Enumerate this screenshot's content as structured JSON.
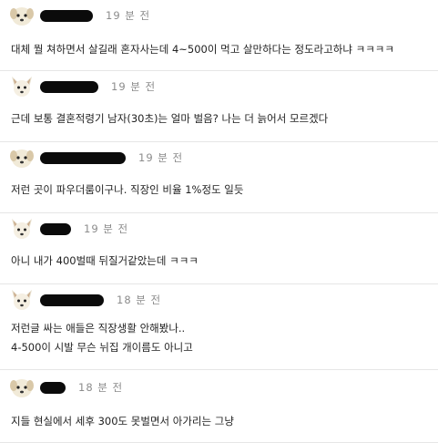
{
  "comments": [
    {
      "avatar": "white-puppy-avatar",
      "time": "19 분 전",
      "lines": [
        "대체 뭘 쳐하면서 살길래 혼자사는데 4~500이 먹고 살만하다는 정도라고하냐 ㅋㅋㅋㅋ"
      ]
    },
    {
      "avatar": "fox-avatar",
      "time": "19 분 전",
      "lines": [
        "근데 보통 결혼적령기 남자(30초)는 얼마 벌음? 나는 더 늙어서 모르겠다"
      ]
    },
    {
      "avatar": "white-puppy-avatar",
      "time": "19 분 전",
      "lines": [
        "저런 곳이 파우더룸이구나. 직장인 비율 1%정도 일듯"
      ]
    },
    {
      "avatar": "fox-avatar",
      "time": "19 분 전",
      "lines": [
        "아니 내가 400벌때 뒤질거같았는데 ㅋㅋㅋ"
      ]
    },
    {
      "avatar": "fox-avatar",
      "time": "18 분 전",
      "lines": [
        "저런글 싸는 애들은 직장생활 안해봤나..",
        "4-500이 시발 무슨 뉘집 개이름도 아니고"
      ]
    },
    {
      "avatar": "white-puppy-avatar",
      "time": "18 분 전",
      "lines": [
        "지들 현실에서 세후 300도 못벌면서 아가리는 그냥"
      ]
    }
  ]
}
